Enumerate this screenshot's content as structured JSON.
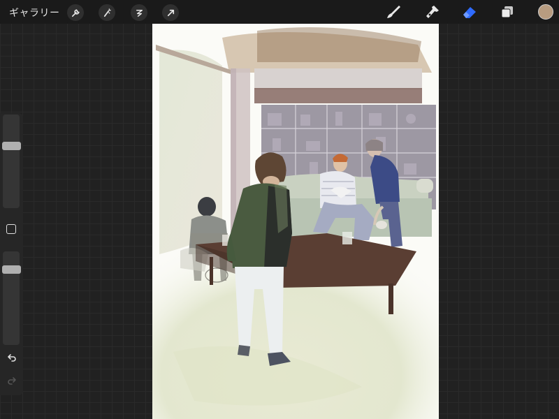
{
  "toolbar": {
    "gallery_label": "ギャラリー",
    "left_tools": [
      "wrench-icon",
      "magic-wand-icon",
      "selection-icon",
      "transform-arrow-icon"
    ],
    "right_tools": [
      "brush-icon",
      "smudge-icon",
      "eraser-icon",
      "layers-icon"
    ],
    "active_tool": "eraser-icon",
    "active_color": "#b79c80",
    "accent_color": "#2f6bff"
  },
  "sidebar": {
    "brush_size_level": 0.68,
    "opacity_level": 0.84,
    "undo_icon": "undo-icon",
    "redo_icon": "redo-icon"
  },
  "canvas": {
    "artwork": "watercolor-illustration"
  }
}
